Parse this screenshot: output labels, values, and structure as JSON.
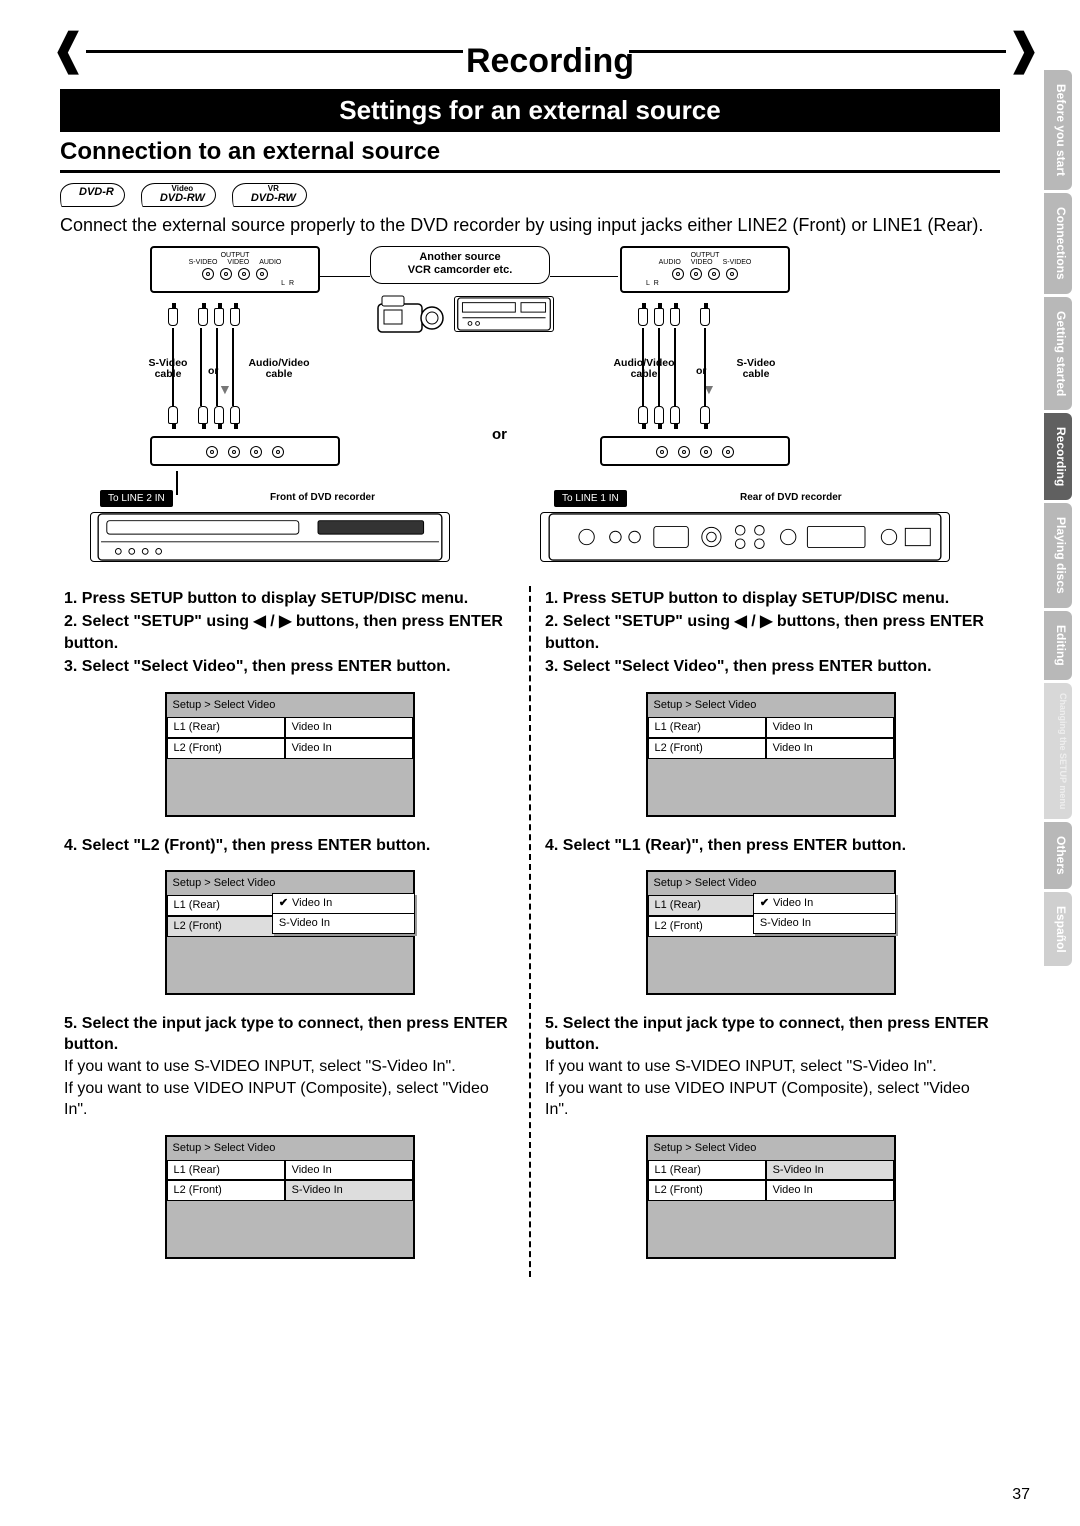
{
  "chapter": "Recording",
  "section": "Settings for an external source",
  "subsection": "Connection to an external source",
  "badges": [
    {
      "sup": "",
      "label": "DVD-R"
    },
    {
      "sup": "Video",
      "label": "DVD-RW"
    },
    {
      "sup": "VR",
      "label": "DVD-RW"
    }
  ],
  "intro": "Connect the external source properly to the DVD recorder by using input jacks either LINE2 (Front) or LINE1 (Rear).",
  "diagram": {
    "output": "OUTPUT",
    "jacks_left": [
      "S-VIDEO",
      "VIDEO",
      "AUDIO"
    ],
    "jacks_right": [
      "AUDIO",
      "VIDEO",
      "S-VIDEO"
    ],
    "another_source": "Another source",
    "vcr_camcorder": "VCR camcorder etc.",
    "svideo_cable": "S-Video\ncable",
    "or": "or",
    "av_cable": "Audio/Video\ncable",
    "or_center": "or",
    "to_line2": "To LINE 2 IN",
    "to_line1": "To LINE 1 IN",
    "front_label": "Front of DVD recorder",
    "rear_label": "Rear of DVD recorder",
    "lr": {
      "l": "L",
      "r": "R"
    }
  },
  "steps_common": {
    "s1": "1. Press SETUP button to display SETUP/DISC menu.",
    "s2": "2. Select \"SETUP\" using ◀ / ▶ buttons, then press ENTER button.",
    "s3": "3. Select \"Select Video\", then press ENTER button.",
    "s5": "5. Select the input jack type to connect, then press ENTER button.",
    "s5_body1": "If you want to use S-VIDEO INPUT, select \"S-Video In\".",
    "s5_body2": "If you want to use VIDEO INPUT (Composite), select \"Video In\"."
  },
  "left": {
    "s4": "4. Select \"L2 (Front)\", then press ENTER button."
  },
  "right": {
    "s4": "4. Select \"L1 (Rear)\", then press ENTER button."
  },
  "menu": {
    "crumb": "Setup > Select Video",
    "l1": "L1 (Rear)",
    "l2": "L2 (Front)",
    "video_in": "Video In",
    "svideo_in": "S-Video In"
  },
  "tabs": [
    "Before you start",
    "Connections",
    "Getting started",
    "Recording",
    "Playing discs",
    "Editing",
    "Changing the SETUP menu",
    "Others",
    "Español"
  ],
  "page_num": "37"
}
